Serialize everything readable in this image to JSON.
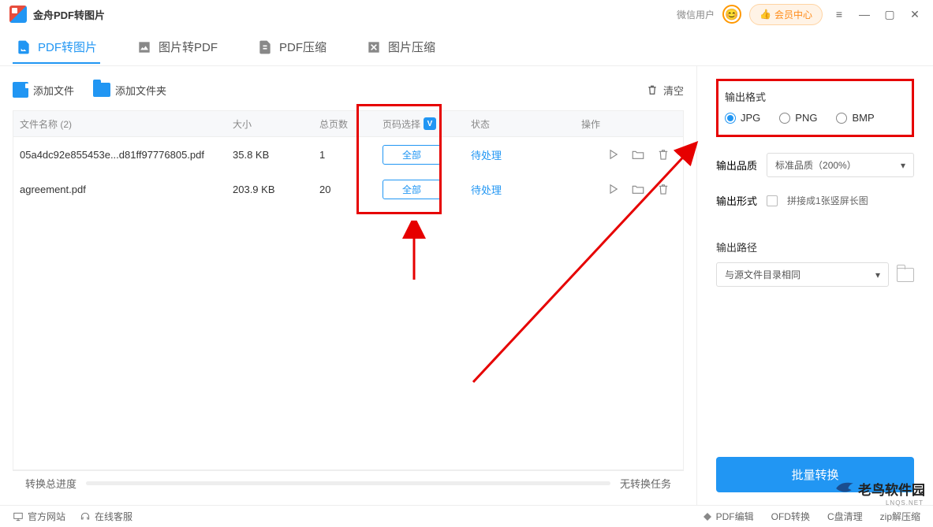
{
  "app": {
    "title": "金舟PDF转图片"
  },
  "titlebar": {
    "wx_label": "微信用户",
    "vip_label": "会员中心"
  },
  "tabs": [
    {
      "label": "PDF转图片",
      "active": true
    },
    {
      "label": "图片转PDF",
      "active": false
    },
    {
      "label": "PDF压缩",
      "active": false
    },
    {
      "label": "图片压缩",
      "active": false
    }
  ],
  "toolbar": {
    "add_file": "添加文件",
    "add_folder": "添加文件夹",
    "clear": "清空"
  },
  "table": {
    "headers": {
      "name": "文件名称  (2)",
      "size": "大小",
      "pages": "总页数",
      "select": "页码选择",
      "status": "状态",
      "ops": "操作"
    },
    "rows": [
      {
        "name": "05a4dc92e855453e...d81ff97776805.pdf",
        "size": "35.8 KB",
        "pages": "1",
        "select": "全部",
        "status": "待处理"
      },
      {
        "name": "agreement.pdf",
        "size": "203.9 KB",
        "pages": "20",
        "select": "全部",
        "status": "待处理"
      }
    ]
  },
  "right": {
    "format_label": "输出格式",
    "formats": [
      "JPG",
      "PNG",
      "BMP"
    ],
    "format_selected": "JPG",
    "quality_label": "输出品质",
    "quality_value": "标准品质（200%）",
    "mode_label": "输出形式",
    "mode_checkbox": "拼接成1张竖屏长图",
    "path_label": "输出路径",
    "path_value": "与源文件目录相同",
    "convert": "批量转换"
  },
  "progress": {
    "label": "转换总进度",
    "status": "无转换任务"
  },
  "footer": {
    "site": "官方网站",
    "service": "在线客服",
    "links": [
      "PDF编辑",
      "OFD转换",
      "C盘清理",
      "zip解压缩"
    ]
  },
  "watermark": {
    "text": "老鸟软件园",
    "sub": "LNQS.NET"
  }
}
